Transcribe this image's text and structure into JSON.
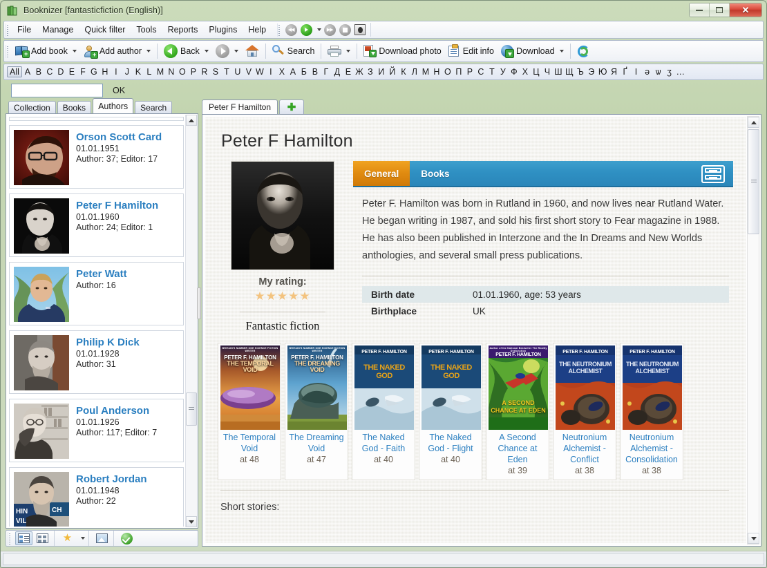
{
  "window": {
    "title": "Booknizer [fantasticfiction (English)]",
    "icon": "books-icon",
    "buttons": {
      "minimize": "minimize-button",
      "maximize": "maximize-button",
      "close": "close-button"
    }
  },
  "menubar": {
    "items": [
      "File",
      "Manage",
      "Quick filter",
      "Tools",
      "Reports",
      "Plugins",
      "Help"
    ],
    "media_buttons": [
      "rewind-button",
      "play-button",
      "play-dropdown",
      "forward-button",
      "stop-button",
      "audio-button"
    ]
  },
  "toolbar": {
    "add_book": "Add book",
    "add_author": "Add author",
    "back": "Back",
    "home": "home-button",
    "search": "Search",
    "print": "print-button",
    "download_photo": "Download photo",
    "edit_info": "Edit info",
    "download": "Download",
    "refresh": "refresh-button"
  },
  "alphabet": {
    "all": "All",
    "letters": [
      "A",
      "B",
      "C",
      "D",
      "E",
      "F",
      "G",
      "H",
      "I",
      "J",
      "K",
      "L",
      "M",
      "N",
      "O",
      "P",
      "R",
      "S",
      "T",
      "U",
      "V",
      "W",
      "I",
      "X",
      "А",
      "Б",
      "В",
      "Г",
      "Д",
      "Е",
      "Ж",
      "З",
      "И",
      "Й",
      "К",
      "Л",
      "М",
      "Н",
      "О",
      "П",
      "Р",
      "С",
      "Т",
      "У",
      "Ф",
      "Х",
      "Ц",
      "Ч",
      "Ш",
      "Щ",
      "Ъ",
      "Э",
      "Ю",
      "Я",
      "Ґ",
      "І",
      "ә",
      "ѡ",
      "ӡ",
      "…"
    ],
    "selected": "All"
  },
  "quickfilter": {
    "value": "",
    "placeholder": "",
    "ok_label": "OK"
  },
  "left_panel": {
    "tabs": [
      {
        "label": "Collection",
        "active": false
      },
      {
        "label": "Books",
        "active": false
      },
      {
        "label": "Authors",
        "active": true
      },
      {
        "label": "Search",
        "active": false
      }
    ],
    "authors": [
      {
        "name": "Orson Scott Card",
        "date": "01.01.1951",
        "counts": "Author: 37; Editor: 17",
        "photo": "orson-scott-card-photo"
      },
      {
        "name": "Peter F Hamilton",
        "date": "01.01.1960",
        "counts": "Author: 24; Editor: 1",
        "photo": "peter-f-hamilton-photo"
      },
      {
        "name": "Peter Watt",
        "date": "",
        "counts": "Author: 16",
        "photo": "peter-watt-photo"
      },
      {
        "name": "Philip K Dick",
        "date": "01.01.1928",
        "counts": "Author: 31",
        "photo": "philip-k-dick-photo"
      },
      {
        "name": "Poul Anderson",
        "date": "01.01.1926",
        "counts": "Author: 117; Editor: 7",
        "photo": "poul-anderson-photo"
      },
      {
        "name": "Robert Jordan",
        "date": "01.01.1948",
        "counts": "Author: 22",
        "photo": "robert-jordan-photo"
      }
    ],
    "bottom_buttons": [
      "details-view-button",
      "tiles-view-button",
      "favorites-button",
      "favorites-dropdown",
      "image-view-button",
      "check-button"
    ]
  },
  "right_panel": {
    "tabs": [
      {
        "label": "Peter F Hamilton",
        "active": true
      },
      {
        "label": "",
        "active": false,
        "icon": "add-tab-icon"
      }
    ],
    "page_title": "Peter F Hamilton",
    "photo": "peter-f-hamilton-portrait",
    "rating_label": "My rating:",
    "stars": "★★★★★",
    "stars_count": 5,
    "collection_name": "Fantastic fiction",
    "content_tabs": [
      {
        "label": "General",
        "active": true
      },
      {
        "label": "Books",
        "active": false
      }
    ],
    "content_tab_icon": "drawer-icon",
    "bio": "Peter F. Hamilton was born in Rutland in 1960, and now lives near Rutland Water. He began writing in 1987, and sold his first short story to Fear magazine in 1988. He has also been published in Interzone and the In Dreams and New Worlds anthologies, and several small press publications.",
    "facts": [
      {
        "label": "Birth date",
        "value": "01.01.1960, age: 53 years"
      },
      {
        "label": "Birthplace",
        "value": "UK"
      }
    ],
    "books": [
      {
        "title": "The Temporal Void",
        "at": "at 48",
        "cover": "the-temporal-void-cover",
        "cover_author": "PETER F. HAMILTON",
        "cover_band": "BRITAIN'S NUMBER ONE SCIENCE FICTION WRITER",
        "cover_title": "THE TEMPORAL VOID"
      },
      {
        "title": "The Dreaming Void",
        "at": "at 47",
        "cover": "the-dreaming-void-cover",
        "cover_author": "PETER F. HAMILTON",
        "cover_band": "BRITAIN'S NUMBER ONE SCIENCE FICTION WRITER",
        "cover_title": "THE DREAMING VOID"
      },
      {
        "title": "The Naked God - Faith",
        "at": "at 40",
        "cover": "the-naked-god-faith-cover",
        "cover_author": "PETER F. HAMILTON",
        "cover_band": "",
        "cover_title": "THE NAKED GOD"
      },
      {
        "title": "The Naked God - Flight",
        "at": "at 40",
        "cover": "the-naked-god-flight-cover",
        "cover_author": "PETER F. HAMILTON",
        "cover_band": "",
        "cover_title": "THE NAKED GOD"
      },
      {
        "title": "A Second Chance at Eden",
        "at": "at 39",
        "cover": "a-second-chance-at-eden-cover",
        "cover_author": "PETER F. HAMILTON",
        "cover_band": "Author of the National Bestseller The Reality Dysfunction",
        "cover_title": "A SECOND CHANCE AT EDEN"
      },
      {
        "title": "Neutronium Alchemist - Conflict",
        "at": "at 38",
        "cover": "neutronium-alchemist-conflict-cover",
        "cover_author": "PETER F. HAMILTON",
        "cover_band": "",
        "cover_title": "THE NEUTRONIUM ALCHEMIST"
      },
      {
        "title": "Neutronium Alchemist - Consolidation",
        "at": "at 38",
        "cover": "neutronium-alchemist-consolidation-cover",
        "cover_author": "PETER F. HAMILTON",
        "cover_band": "",
        "cover_title": "THE NEUTRONIUM ALCHEMIST"
      }
    ],
    "short_stories_label": "Short stories:"
  },
  "colors": {
    "accent_blue": "#2f90c3",
    "accent_orange": "#e08a10",
    "link_blue": "#2b7fc0",
    "window_green": "#c2d4af",
    "fact_row_alt": "#dfe8ea"
  }
}
